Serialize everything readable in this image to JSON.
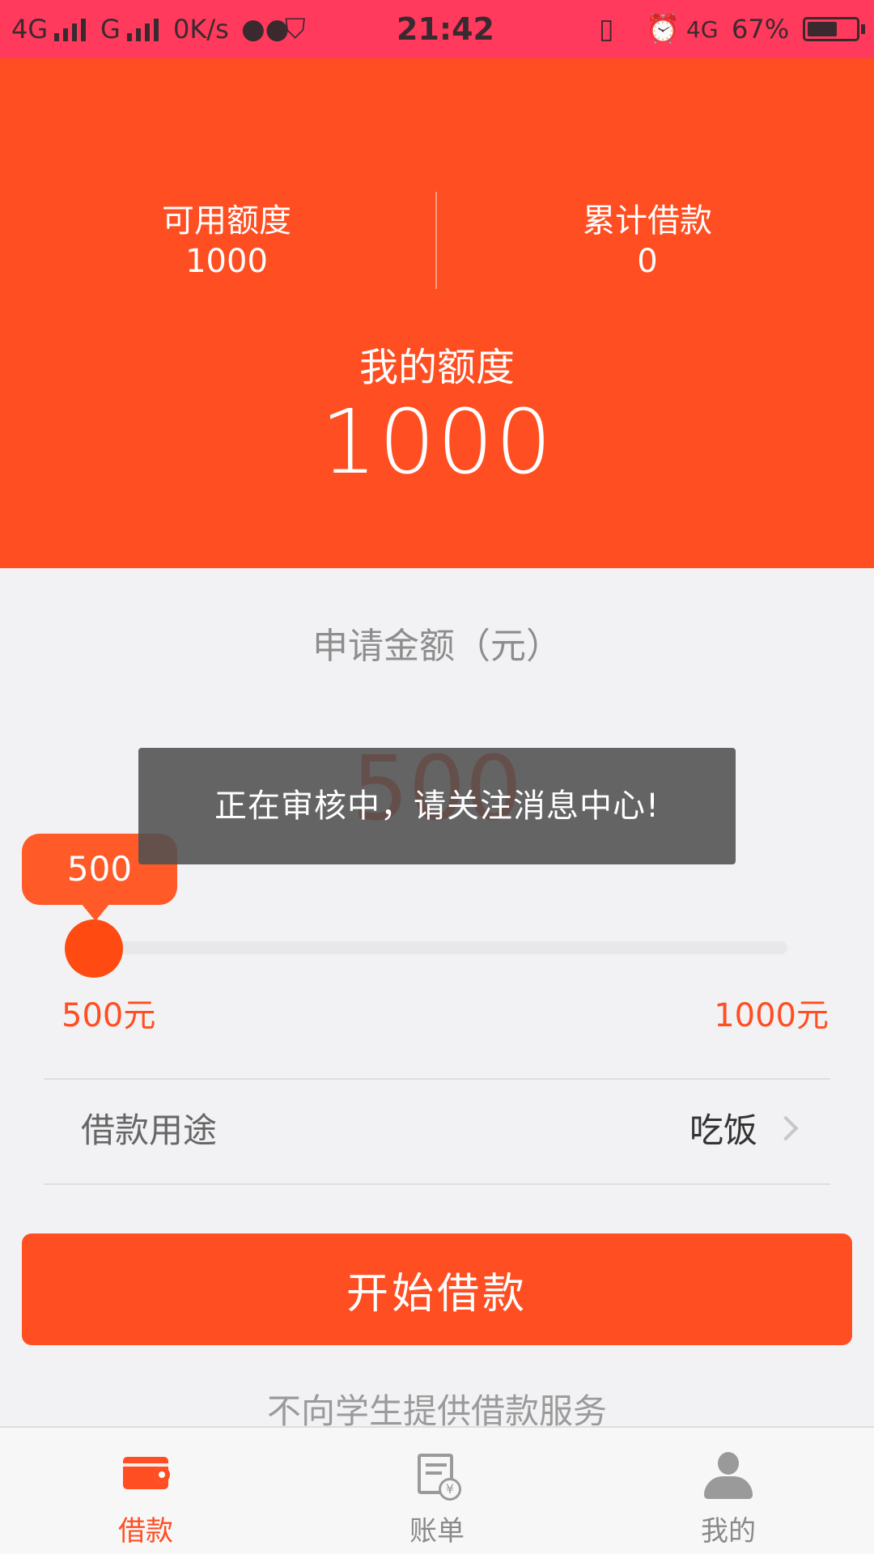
{
  "status_bar": {
    "network1": "4G",
    "network2": "G",
    "speed": "0K/s",
    "time": "21:42",
    "network3": "4G",
    "battery": "67%"
  },
  "header": {
    "available_label": "可用额度",
    "available_value": "1000",
    "total_label": "累计借款",
    "total_value": "0",
    "quota_title": "我的额度",
    "quota_value": "1000"
  },
  "apply": {
    "label": "申请金额（元）",
    "amount": "500",
    "slider_bubble": "500",
    "slider_value_fraction": 0,
    "min_label": "500元",
    "max_label": "1000元"
  },
  "purpose": {
    "label": "借款用途",
    "value": "吃饭"
  },
  "start_button": "开始借款",
  "notice": "不向学生提供借款服务",
  "toast": "正在审核中，请关注消息中心!",
  "tabs": [
    {
      "label": "借款",
      "icon": "wallet-icon",
      "active": true
    },
    {
      "label": "账单",
      "icon": "bill-icon",
      "active": false
    },
    {
      "label": "我的",
      "icon": "user-icon",
      "active": false
    }
  ],
  "colors": {
    "brand": "#ff4e21",
    "status_bar": "#ff3a5c",
    "background": "#f2f2f4"
  }
}
